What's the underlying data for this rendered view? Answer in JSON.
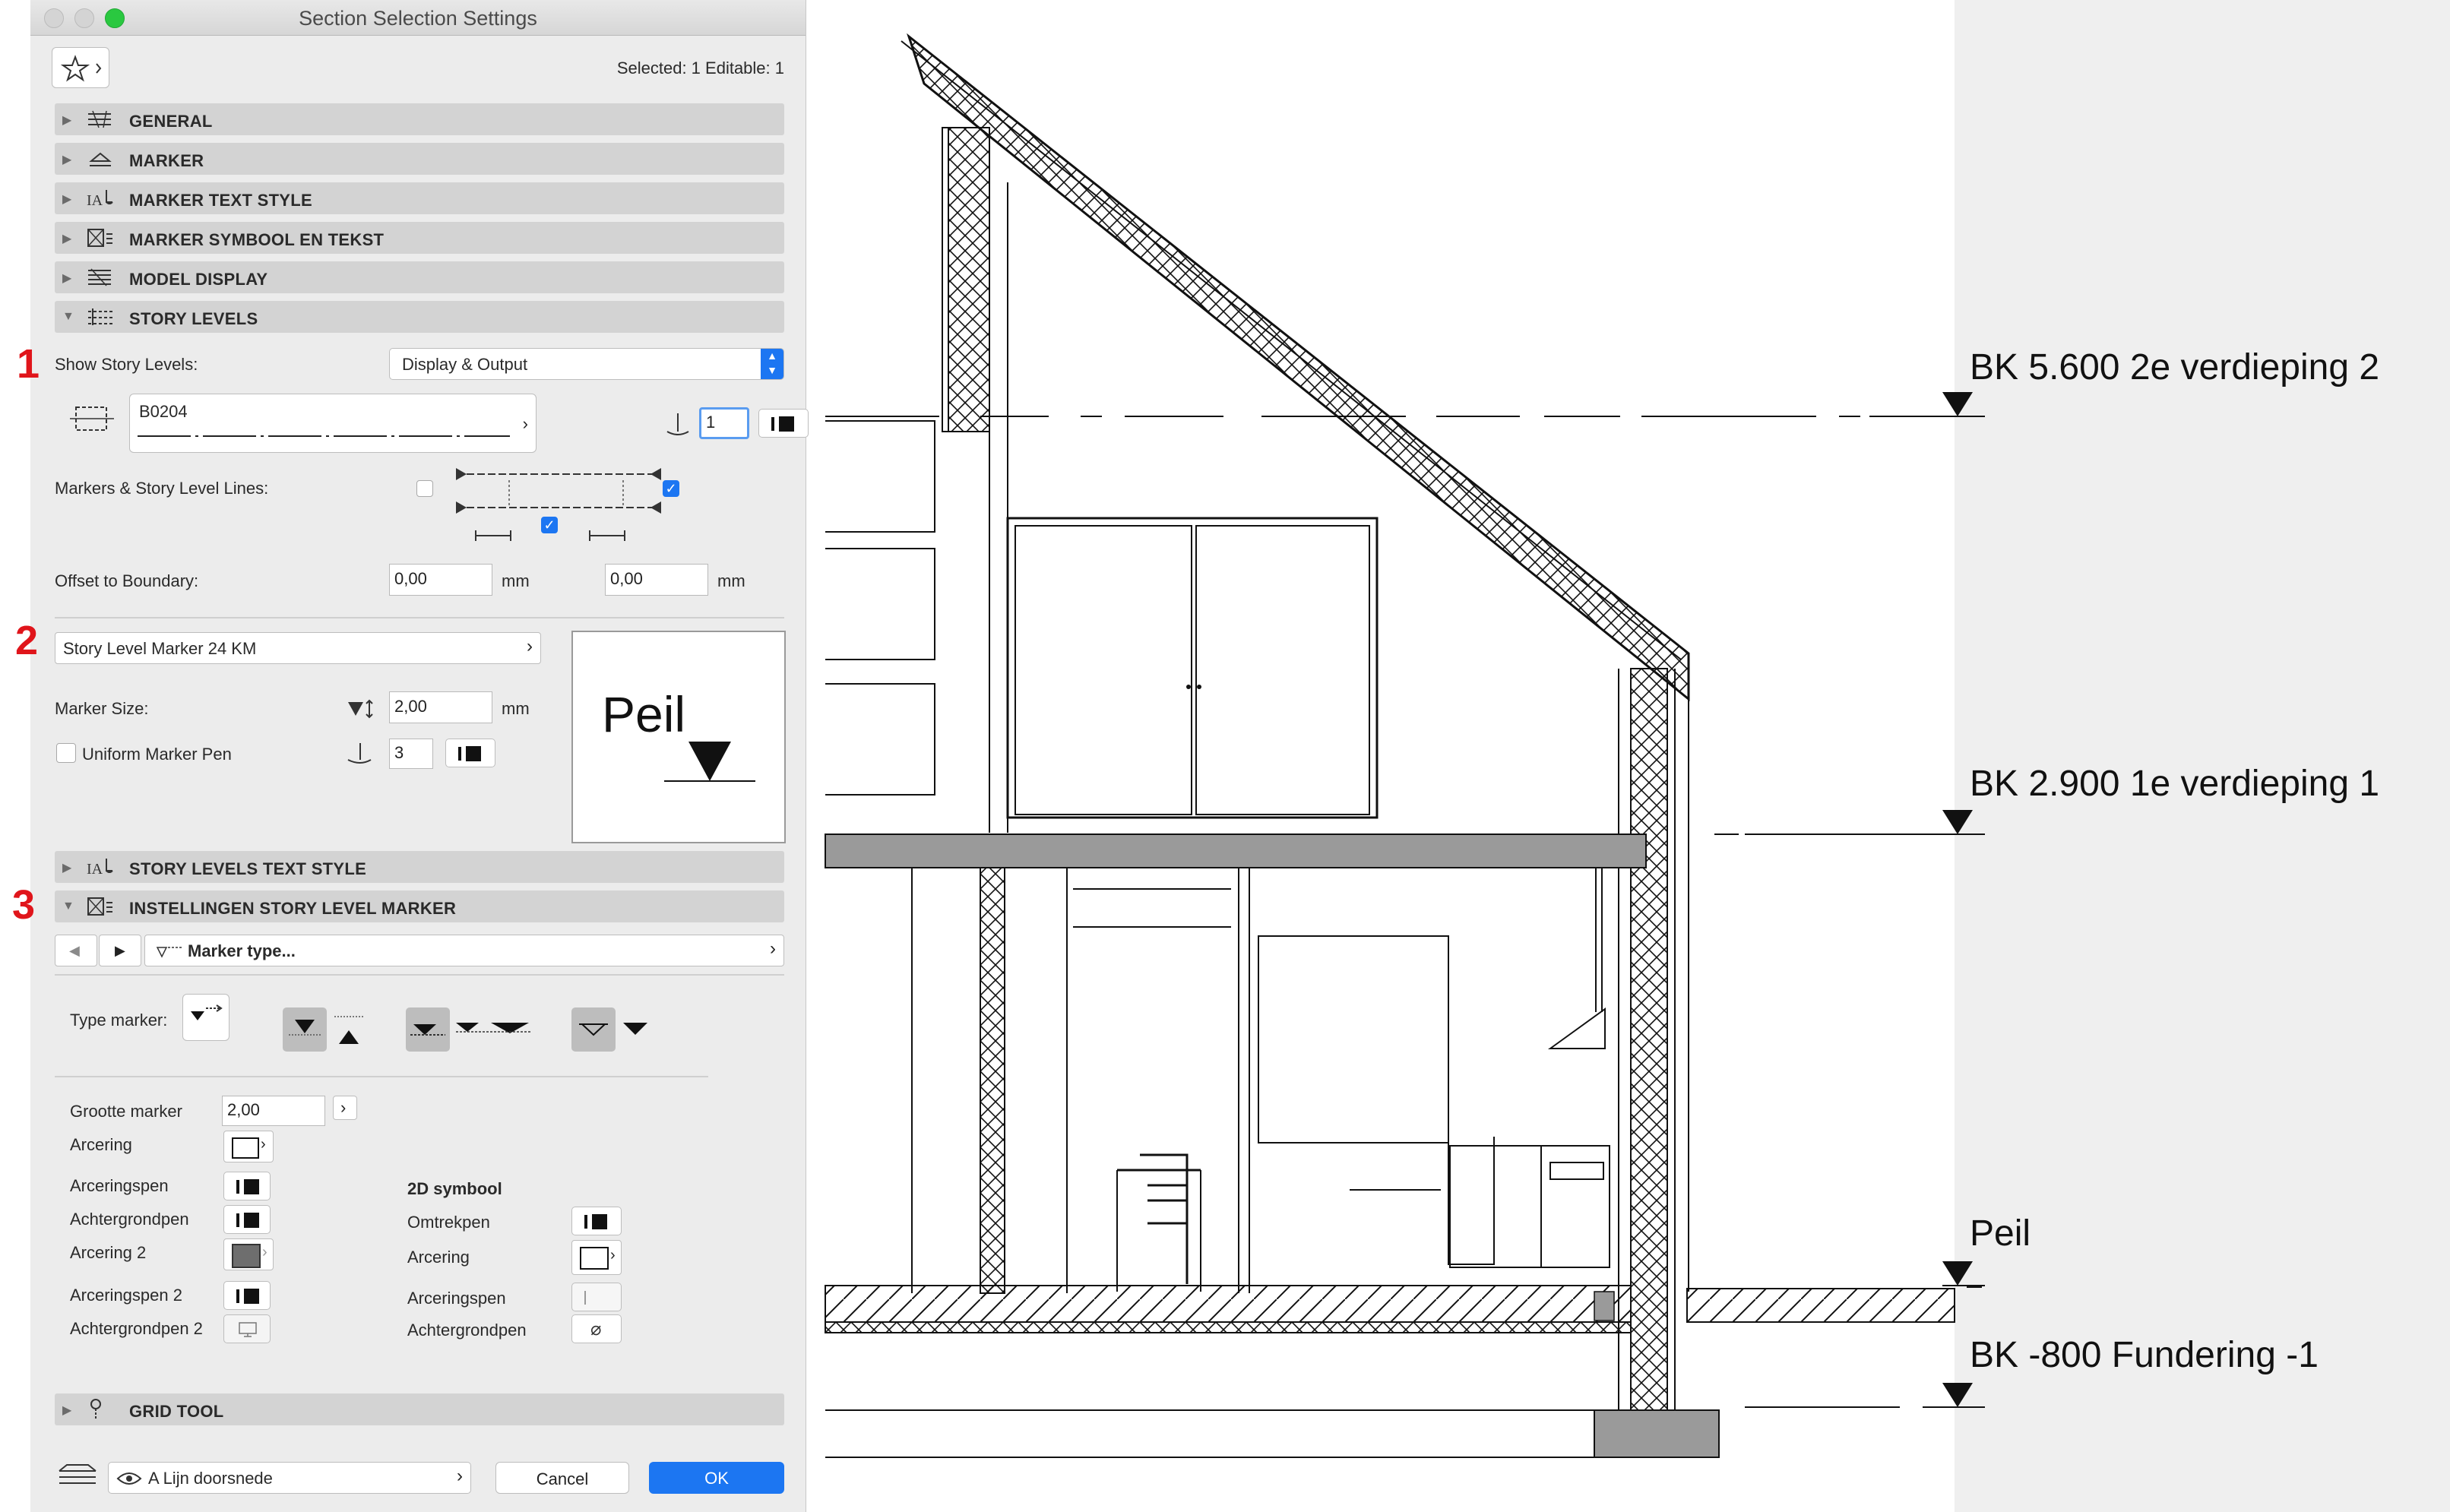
{
  "window": {
    "title": "Section Selection Settings"
  },
  "header": {
    "selection_info": "Selected: 1 Editable: 1"
  },
  "sections": [
    {
      "label": "GENERAL",
      "expanded": false,
      "icon": "general-settings-icon"
    },
    {
      "label": "MARKER",
      "expanded": false,
      "icon": "marker-icon"
    },
    {
      "label": "MARKER TEXT STYLE",
      "expanded": false,
      "icon": "text-style-icon"
    },
    {
      "label": "MARKER SYMBOOL EN TEKST",
      "expanded": false,
      "icon": "symbol-text-icon"
    },
    {
      "label": "MODEL DISPLAY",
      "expanded": false,
      "icon": "model-display-icon"
    },
    {
      "label": "STORY LEVELS",
      "expanded": true,
      "icon": "story-levels-icon"
    },
    {
      "label": "STORY LEVELS TEXT STYLE",
      "expanded": false,
      "icon": "text-style-icon"
    },
    {
      "label": "INSTELLINGEN STORY LEVEL MARKER",
      "expanded": true,
      "icon": "symbol-text-icon"
    },
    {
      "label": "GRID TOOL",
      "expanded": false,
      "icon": "grid-tool-icon"
    }
  ],
  "story_levels": {
    "show_label": "Show Story Levels:",
    "show_value": "Display & Output",
    "line_type": "B0204",
    "pen_value": "1",
    "markers_label": "Markers & Story Level Lines:",
    "markers_left_checked": false,
    "markers_right_checked": true,
    "markers_middle_checked": true,
    "offset_label": "Offset to Boundary:",
    "offset_left": "0,00",
    "offset_right": "0,00",
    "unit": "mm",
    "marker_name": "Story Level Marker 24 KM",
    "marker_size_label": "Marker Size:",
    "marker_size": "2,00",
    "uniform_pen_label": "Uniform Marker Pen",
    "uniform_pen_checked": false,
    "uniform_pen_value": "3",
    "preview_text": "Peil"
  },
  "marker_settings": {
    "marker_type_label": "Marker type...",
    "type_marker_label": "Type marker:",
    "grootte_label": "Grootte marker",
    "grootte_value": "2,00",
    "left_rows": [
      "Arcering",
      "Arceringspen",
      "Achtergrondpen",
      "Arcering 2",
      "Arceringspen 2",
      "Achtergrondpen 2"
    ],
    "symbol_title": "2D symbool",
    "right_rows": [
      "Omtrekpen",
      "Arcering",
      "Arceringspen",
      "Achtergrondpen"
    ]
  },
  "footer": {
    "layer": "A Lijn doorsnede",
    "cancel": "Cancel",
    "ok": "OK"
  },
  "annotations": [
    "1",
    "2",
    "3"
  ],
  "drawing": {
    "levels": [
      "BK 5.600 2e verdieping 2",
      "BK 2.900 1e verdieping 1",
      "Peil",
      "BK -800 Fundering -1"
    ]
  },
  "colors": {
    "accent": "#1c76f2",
    "annotation": "#e0151b",
    "section_header": "#d3d3d3"
  }
}
